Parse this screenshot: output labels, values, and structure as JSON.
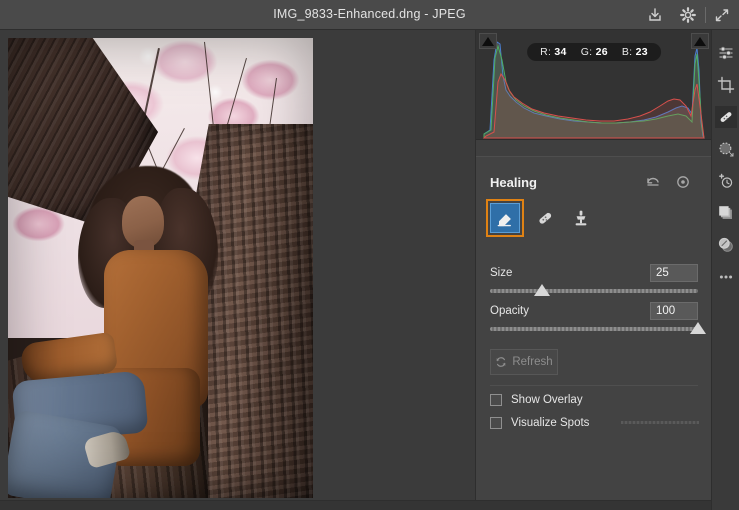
{
  "titlebar": {
    "filename": "IMG_9833-Enhanced.dng  -  JPEG",
    "export_icon": "export-download-icon",
    "gear_icon": "gear-icon",
    "expand_icon": "expand-fullscreen-icon"
  },
  "histogram": {
    "readout": {
      "r_label": "R:",
      "r_value": "34",
      "g_label": "G:",
      "g_value": "26",
      "b_label": "B:",
      "b_value": "23"
    },
    "clip_left_icon": "shadow-clipping-triangle-icon",
    "clip_right_icon": "highlight-clipping-triangle-icon",
    "colors": {
      "red": "#d8504c",
      "green": "#4fae62",
      "blue": "#4a7fd0",
      "luma": "#8d8d8d"
    }
  },
  "panel": {
    "title": "Healing",
    "undo_icon": "undo-reset-icon",
    "visibility_icon": "eye-visibility-icon",
    "tools": [
      {
        "name": "eraser-tool",
        "icon": "eraser-icon",
        "selected": true,
        "highlighted": true
      },
      {
        "name": "patch-tool",
        "icon": "bandage-patch-icon",
        "selected": false,
        "highlighted": false
      },
      {
        "name": "clone-stamp-tool",
        "icon": "clone-stamp-icon",
        "selected": false,
        "highlighted": false
      }
    ],
    "sliders": [
      {
        "label": "Size",
        "value": "25",
        "percent": 25
      },
      {
        "label": "Opacity",
        "value": "100",
        "percent": 100
      }
    ],
    "refresh": {
      "label": "Refresh",
      "icon": "refresh-circular-arrows-icon",
      "enabled": false
    },
    "checkboxes": [
      {
        "label": "Show Overlay",
        "checked": false
      },
      {
        "label": "Visualize Spots",
        "checked": false
      }
    ],
    "accent_selected": "#2f6fa8",
    "accent_highlight": "#e08214"
  },
  "rail": {
    "items": [
      {
        "name": "adjustments-sliders-icon",
        "active": false
      },
      {
        "name": "crop-icon",
        "active": false
      },
      {
        "name": "healing-brush-icon",
        "active": true
      },
      {
        "name": "radial-selection-icon",
        "active": false
      },
      {
        "name": "red-eye-icon",
        "active": false
      },
      {
        "name": "layers-icon",
        "active": false
      },
      {
        "name": "lens-filter-icon",
        "active": false
      },
      {
        "name": "more-options-icon",
        "active": false
      }
    ]
  },
  "canvas": {
    "photo_alt": "Woman in tan suede jacket and jeans sitting in a blossoming cherry tree"
  }
}
